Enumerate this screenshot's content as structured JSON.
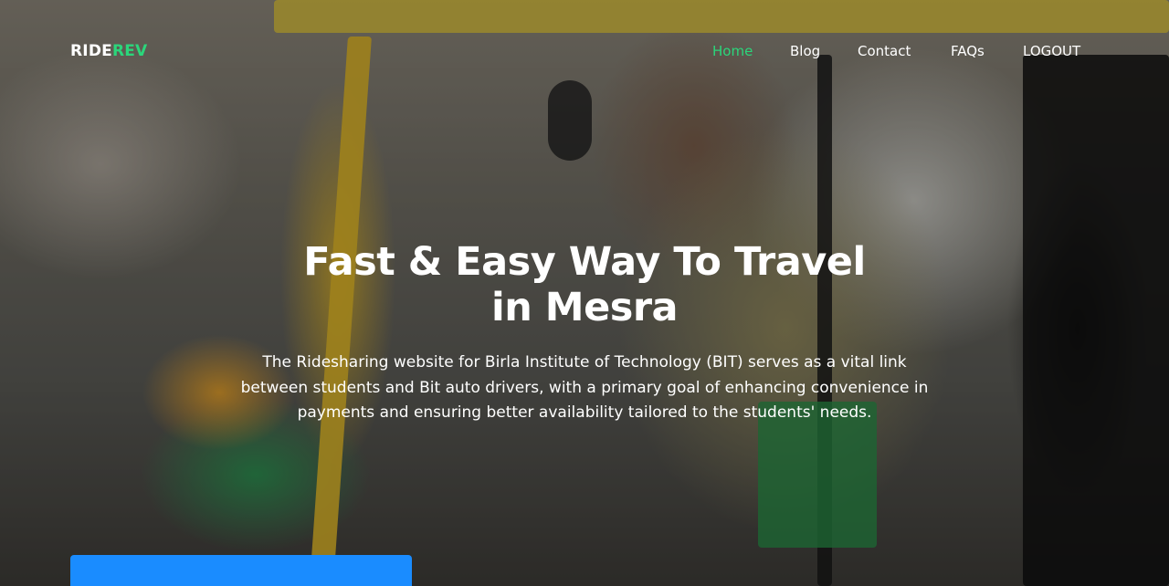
{
  "brand": {
    "name_primary": "RIDE",
    "name_accent": "REV",
    "accent_color": "#2bd67b"
  },
  "nav": {
    "items": [
      {
        "label": "Home",
        "active": true
      },
      {
        "label": "Blog",
        "active": false
      },
      {
        "label": "Contact",
        "active": false
      },
      {
        "label": "FAQs",
        "active": false
      },
      {
        "label": "LOGOUT",
        "active": false
      }
    ]
  },
  "hero": {
    "title": "Fast & Easy Way To Travel in Mesra",
    "description": "The Ridesharing website for Birla Institute of Technology (BIT) serves as a vital link between students and Bit auto drivers, with a primary goal of enhancing convenience in payments and ensuring better availability tailored to the students' needs."
  },
  "colors": {
    "cta": "#1a8cff",
    "text": "#ffffff"
  }
}
